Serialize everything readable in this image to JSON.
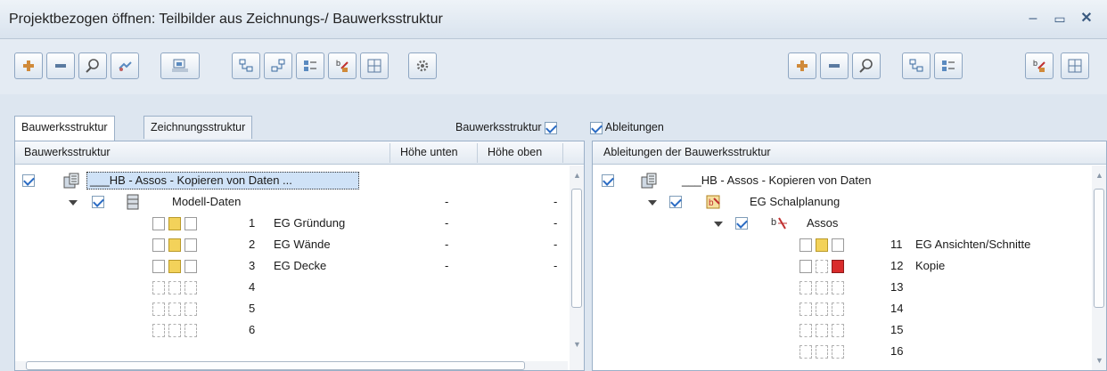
{
  "window": {
    "title": "Projektbezogen öffnen: Teilbilder aus Zeichnungs-/ Bauwerksstruktur",
    "minimize_glyph": "–",
    "maximize_glyph": "▭",
    "close_glyph": "✕"
  },
  "toolbar_left_icons": [
    "add-icon",
    "remove-icon",
    "search-icon",
    "link-icon",
    "structure-icon",
    "tree-expand-icon",
    "tree-collapse-icon",
    "list-view-icon",
    "derive-icon",
    "grid-view-icon",
    "settings-icon"
  ],
  "toolbar_right_icons": [
    "add-icon",
    "remove-icon",
    "search-icon",
    "tree-icon",
    "list-view-icon",
    "derive-icon",
    "grid-view-icon"
  ],
  "tabs": [
    "Bauwerksstruktur",
    "Zeichnungsstruktur"
  ],
  "options": {
    "bauwerk_label": "Bauwerksstruktur",
    "ableitungen_label": "Ableitungen"
  },
  "left_panel": {
    "header": [
      "Bauwerksstruktur",
      "Höhe unten",
      "Höhe oben"
    ],
    "root_label": "___HB - Assos - Kopieren von Daten ...",
    "model_label": "Modell-Daten",
    "rows": [
      {
        "num": "1",
        "name": "EG Gründung",
        "low": "-",
        "high": "-"
      },
      {
        "num": "2",
        "name": "EG Wände",
        "low": "-",
        "high": "-"
      },
      {
        "num": "3",
        "name": "EG Decke",
        "low": "-",
        "high": "-"
      },
      {
        "num": "4",
        "name": "",
        "low": "",
        "high": ""
      },
      {
        "num": "5",
        "name": "",
        "low": "",
        "high": ""
      },
      {
        "num": "6",
        "name": "",
        "low": "",
        "high": ""
      }
    ]
  },
  "right_panel": {
    "header": "Ableitungen der Bauwerksstruktur",
    "root_label": "___HB - Assos - Kopieren von Daten",
    "group_label": "EG Schalplanung",
    "sub_label": "Assos",
    "rows": [
      {
        "num": "11",
        "name": "EG Ansichten/Schnitte"
      },
      {
        "num": "12",
        "name": "Kopie"
      },
      {
        "num": "13",
        "name": ""
      },
      {
        "num": "14",
        "name": ""
      },
      {
        "num": "15",
        "name": ""
      },
      {
        "num": "16",
        "name": ""
      }
    ]
  },
  "colors": {
    "accent": "#2b6cc4",
    "panel_border": "#9bb0c8",
    "background": "#dde6f0"
  }
}
